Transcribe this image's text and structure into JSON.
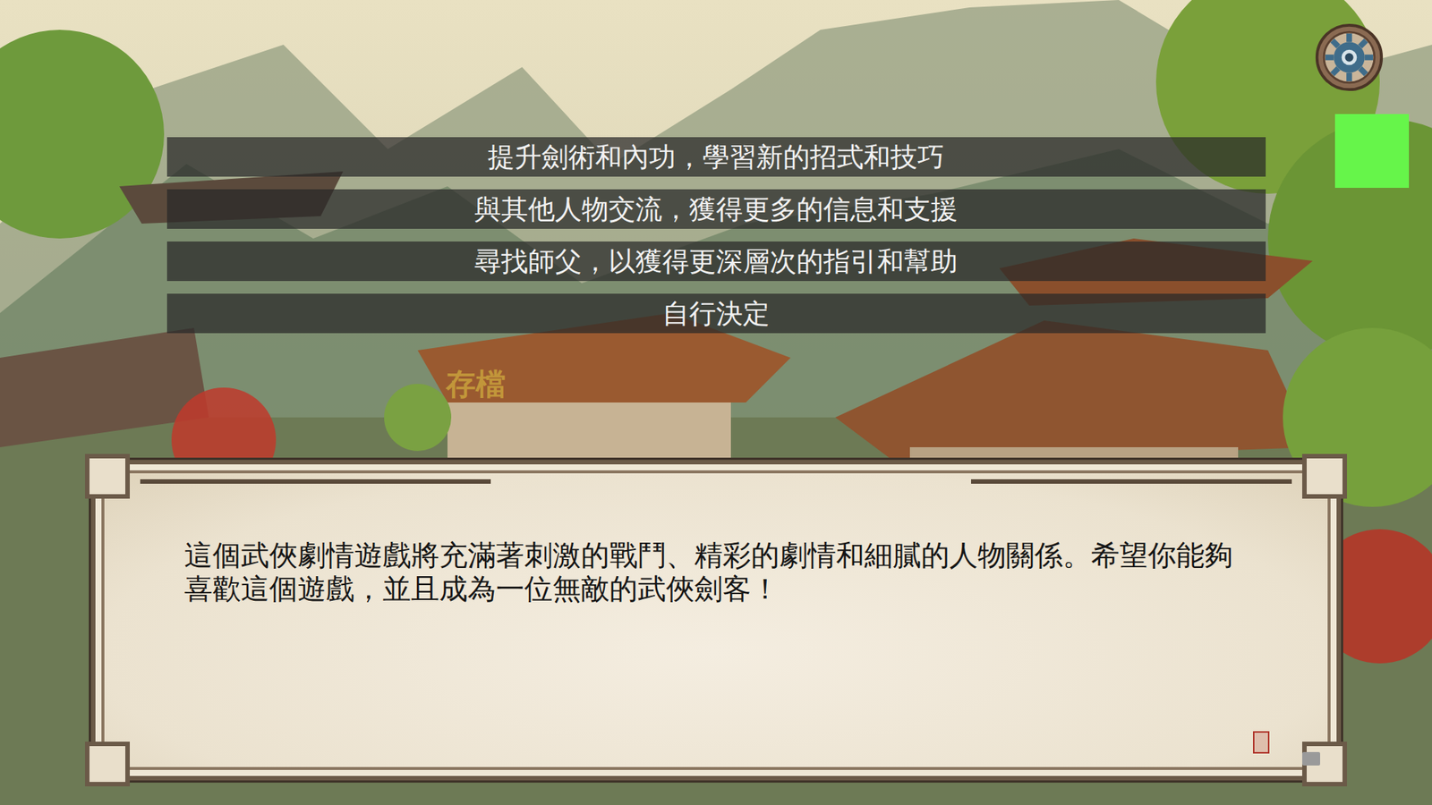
{
  "choices": [
    {
      "label": "提升劍術和內功，學習新的招式和技巧"
    },
    {
      "label": "與其他人物交流，獲得更多的信息和支援"
    },
    {
      "label": "尋找師父，以獲得更深層次的指引和幫助"
    },
    {
      "label": "自行決定"
    }
  ],
  "save_label": "存檔",
  "dialog": {
    "text": "這個武俠劇情遊戲將充滿著刺激的戰鬥、精彩的劇情和細膩的人物關係。希望你能夠喜歡這個遊戲，並且成為一位無敵的武俠劍客！"
  }
}
